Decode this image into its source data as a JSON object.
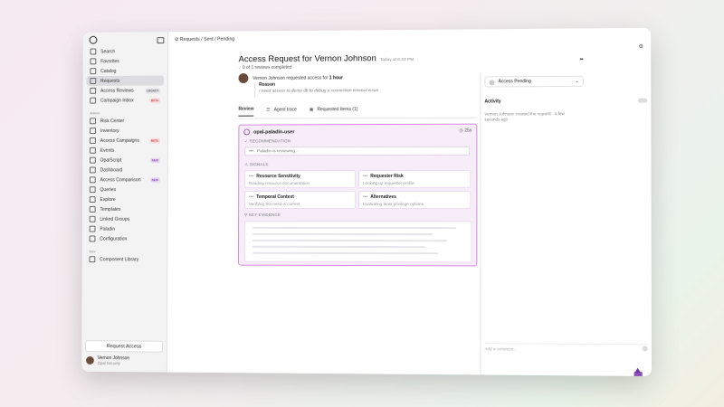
{
  "sidebar": {
    "items_top": [
      {
        "label": "Search"
      },
      {
        "label": "Favorites"
      },
      {
        "label": "Catalog"
      },
      {
        "label": "Requests",
        "active": true
      },
      {
        "label": "Access Reviews",
        "badge": "LEGACY"
      },
      {
        "label": "Campaign Inbox",
        "badge": "BETA"
      }
    ],
    "admin_label": "Admin",
    "items_admin": [
      {
        "label": "Risk Center"
      },
      {
        "label": "Inventory"
      },
      {
        "label": "Access Campaigns",
        "badge": "BETA"
      },
      {
        "label": "Events"
      },
      {
        "label": "OpalScript",
        "badge": "NEW"
      },
      {
        "label": "Dashboard"
      },
      {
        "label": "Access Comparison",
        "badge": "NEW"
      },
      {
        "label": "Queries"
      },
      {
        "label": "Explore"
      },
      {
        "label": "Templates"
      },
      {
        "label": "Linked Groups"
      },
      {
        "label": "Paladin"
      },
      {
        "label": "Configuration"
      }
    ],
    "dev_label": "Dev",
    "items_dev": [
      {
        "label": "Component Library"
      }
    ],
    "request_access": "Request Access",
    "user": {
      "name": "Vernon Johnson",
      "org": "Opal Security"
    }
  },
  "header": {
    "breadcrumb": "Requests / Sent / Pending",
    "title": "Access Request for Vernon Johnson",
    "timestamp": "Today at 6:33 PM",
    "reviews": "0 of 1 reviews completed"
  },
  "request": {
    "line_prefix": "Vernon Johnson requested access for",
    "duration": "1 hour",
    "reason_label": "Reason",
    "reason_text": "I need access to demo db to debug a connection timeout issue"
  },
  "tabs": [
    {
      "label": "Review",
      "active": true
    },
    {
      "label": "Agent trace"
    },
    {
      "label": "Requested Items (1)"
    }
  ],
  "paladin": {
    "user": "opal-paladin-user",
    "timer": "25s",
    "recommendation_label": "RECOMMENDATION",
    "recommendation_text": "Paladin is reviewing...",
    "signals_label": "SIGNALS",
    "signals": [
      {
        "title": "Resource Sensitivity",
        "desc": "Reading resource documentation"
      },
      {
        "title": "Requester Risk",
        "desc": "Looking up requester profile"
      },
      {
        "title": "Temporal Context",
        "desc": "Verifying the need is current"
      },
      {
        "title": "Alternatives",
        "desc": "Evaluating least privilege options"
      }
    ],
    "evidence_label": "KEY EVIDENCE"
  },
  "right_panel": {
    "status": "Access Pending",
    "activity_label": "Activity",
    "activity_text": "Vernon Johnson created the request · a few seconds ago",
    "comment_placeholder": "Add a comment..."
  },
  "colors": {
    "accent": "#b84fc8",
    "panel_bg": "#f7edf9"
  }
}
